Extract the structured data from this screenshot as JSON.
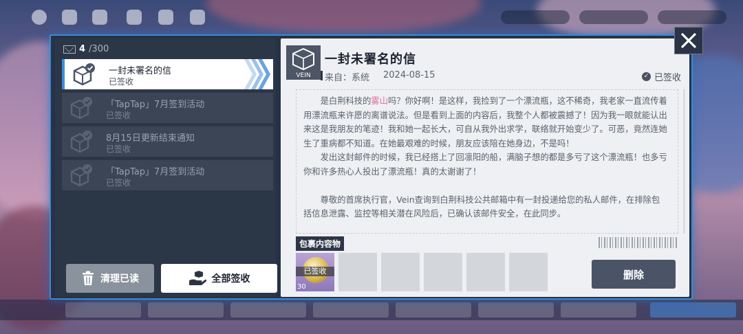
{
  "inbox": {
    "count_current": "4",
    "count_total": "/300",
    "items": [
      {
        "title": "一封未署名的信",
        "status": "已签收"
      },
      {
        "title": "「TapTap」7月签到活动",
        "status": "已签收"
      },
      {
        "title": "8月15日更新结束通知",
        "status": "已签收"
      },
      {
        "title": "「TapTap」7月签到活动",
        "status": "已签收"
      }
    ],
    "clear_label": "清理已读",
    "claim_all_label": "全部签收"
  },
  "mail": {
    "logo_text": "VEIN",
    "title": "一封未署名的信",
    "from_label": "来自：系统",
    "date": "2024-08-15",
    "status": "已签收",
    "body": {
      "p1_a": "是白荆科技的",
      "p1_highlight": "雾山",
      "p1_b": "吗？你好啊！是这样，我捡到了一个漂流瓶，这不稀奇，我老家一直流传着用漂流瓶来许愿的离谱说法。但是看到上面的内容后，我整个人都被震撼了！因为我一眼就能认出来这是我朋友的笔迹！我和她一起长大，可自从我外出求学，联络就开始变少了。可恶，竟然连她生了重病都不知道。在她最艰难的时候，朋友应该陪在她身边，不是吗！",
      "p2": "发出这封邮件的时候，我已经搭上了回凛阳的船，满脑子想的都是多亏了这个漂流瓶！也多亏你和许多热心人投出了漂流瓶！真的太谢谢了！",
      "p3": "尊敬的首席执行官，Vein查询到白荆科技公共邮箱中有一封投递给您的私人邮件，在排除包括信息泄露、监控等相关潜在风险后，已确认该邮件安全，在此同步。"
    },
    "package_label": "包裹内容物",
    "attachment": {
      "signed_label": "已签收",
      "quantity": "30"
    },
    "delete_label": "删除"
  },
  "colors": {
    "accent": "#3d8fde",
    "highlight": "#e56aa0",
    "panel": "#253247"
  },
  "icons": {
    "close": "close-icon",
    "trash": "trash-icon",
    "hand": "hand-package-icon",
    "envelope": "envelope-icon"
  }
}
